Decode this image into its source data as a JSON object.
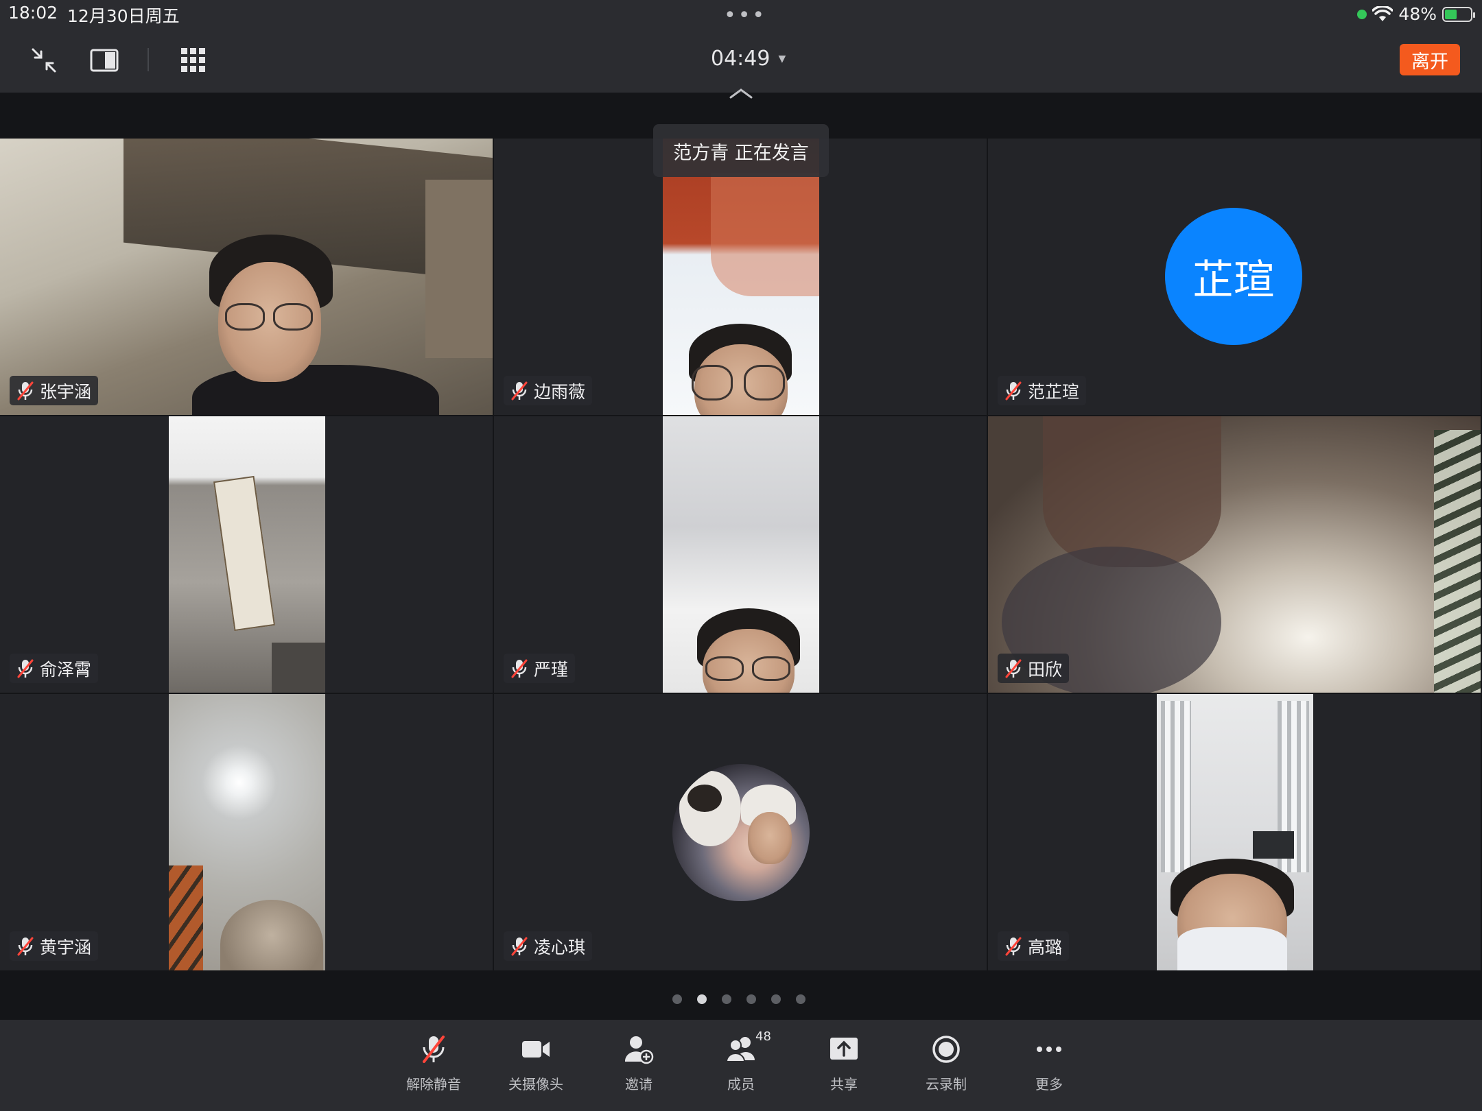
{
  "status_bar": {
    "time": "18:02",
    "date": "12月30日周五",
    "battery": "48%",
    "battery_level": 0.48
  },
  "top_toolbar": {
    "timer": "04:49",
    "leave_label": "离开",
    "icons": [
      "shrink-icon",
      "sidebar-toggle-icon",
      "grid-view-icon",
      "chevron-up-icon"
    ]
  },
  "speaker_banner": "范方青 正在发言",
  "participants": [
    {
      "name": "张宇涵",
      "muted": true
    },
    {
      "name": "边雨薇",
      "muted": true
    },
    {
      "name": "范芷瑄",
      "muted": true,
      "avatar_text": "芷瑄",
      "avatar_color": "#0a84ff"
    },
    {
      "name": "俞泽霄",
      "muted": true
    },
    {
      "name": "严瑾",
      "muted": true
    },
    {
      "name": "田欣",
      "muted": true
    },
    {
      "name": "黄宇涵",
      "muted": true
    },
    {
      "name": "凌心琪",
      "muted": true
    },
    {
      "name": "高璐",
      "muted": true
    }
  ],
  "pagination": {
    "pages": 6,
    "current": 2
  },
  "bottom_toolbar": {
    "items": [
      {
        "label": "解除静音",
        "icon": "mic-muted-icon"
      },
      {
        "label": "关摄像头",
        "icon": "camera-icon"
      },
      {
        "label": "邀请",
        "icon": "invite-user-icon"
      },
      {
        "label": "成员",
        "icon": "members-icon",
        "badge": "48"
      },
      {
        "label": "共享",
        "icon": "share-icon"
      },
      {
        "label": "云录制",
        "icon": "record-icon"
      },
      {
        "label": "更多",
        "icon": "more-icon"
      }
    ]
  },
  "colors": {
    "accent_leave": "#f45a1e",
    "avatar_blue": "#0a84ff",
    "muted_red": "#ff453a",
    "status_green": "#34c759"
  }
}
